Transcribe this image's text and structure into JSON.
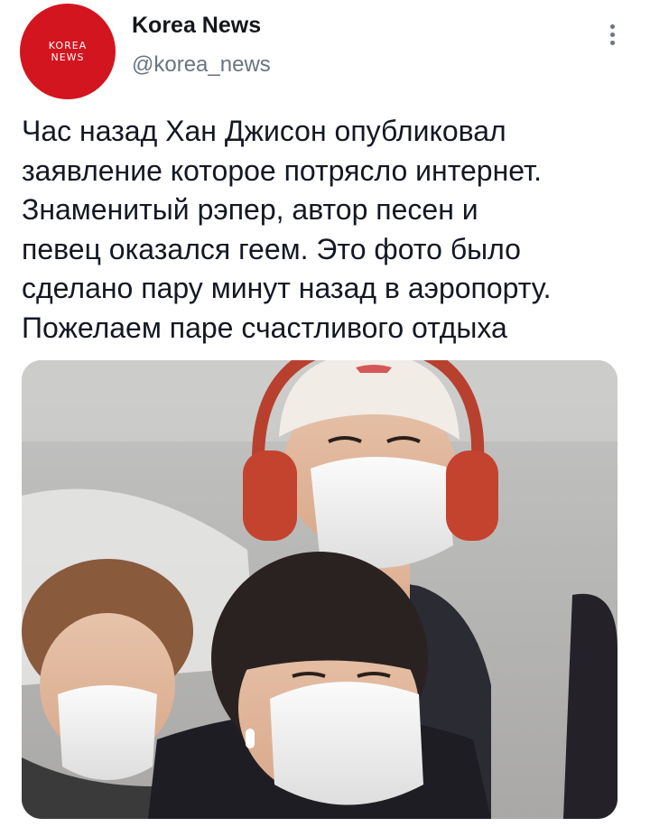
{
  "account": {
    "avatar_text_line1": "KOREA",
    "avatar_text_line2": "NEWS",
    "display_name": "Korea News",
    "handle": "@korea_news",
    "avatar_color": "#d3151f"
  },
  "menu": {
    "icon": "more-vertical-icon"
  },
  "tweet": {
    "text_lines": [
      "Час назад Хан Джисон опубликовал",
      "заявление которое потрясло интернет.",
      "Знаменитый рэпер, автор песен и",
      "певец оказался геем. Это фото было",
      "сделано пару минут назад в аэропорту.",
      "Пожелаем паре счастливого отдыха"
    ]
  },
  "media": {
    "kind": "photo",
    "subject": "two people in face masks at an airport, one wearing red headphones and a white beanie"
  },
  "colors": {
    "text": "#141823",
    "secondary_text": "#69757f",
    "background": "#ffffff"
  }
}
